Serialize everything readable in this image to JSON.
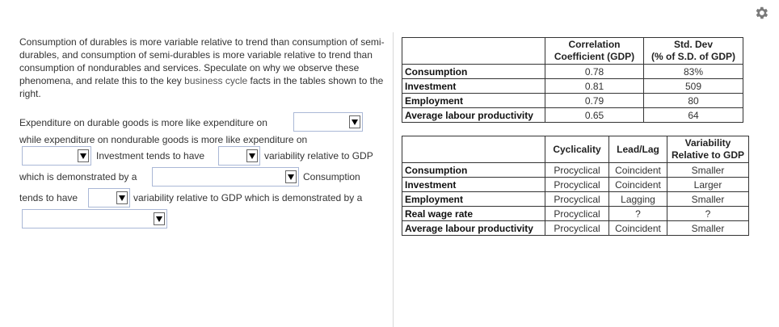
{
  "intro_text_1": "Consumption of durables is more variable relative to trend than consumption of semi-durables, and consumption of semi-durables is more variable relative to trend than consumption of nondurables and services. Speculate on why we observe these phenomena, and relate this to the key ",
  "intro_link": "business cycle",
  "intro_text_2": " facts in the tables shown to the right.",
  "sentence": {
    "s1": "Expenditure on durable goods is more like expenditure on",
    "s2": "while expenditure on nondurable goods is more like expenditure on",
    "s3": "Investment tends to have",
    "s4": "variability relative to GDP",
    "s5": "which is demonstrated by a",
    "s6": "Consumption",
    "s7": "tends to have",
    "s8": "variability relative to GDP which is demonstrated by a"
  },
  "table1": {
    "headers": [
      "",
      "Correlation Coefficient (GDP)",
      "Std. Dev (% of S.D. of GDP)"
    ],
    "h1a": "Correlation",
    "h1b": "Coefficient (GDP)",
    "h2a": "Std. Dev",
    "h2b": "(% of S.D. of GDP)",
    "rows": [
      {
        "label": "Consumption",
        "corr": "0.78",
        "sd": "83%"
      },
      {
        "label": "Investment",
        "corr": "0.81",
        "sd": "509"
      },
      {
        "label": "Employment",
        "corr": "0.79",
        "sd": "80"
      },
      {
        "label": "Average labour productivity",
        "corr": "0.65",
        "sd": "64"
      }
    ]
  },
  "table2": {
    "h_cyc": "Cyclicality",
    "h_lead": "Lead/Lag",
    "h_var_a": "Variability",
    "h_var_b": "Relative to GDP",
    "rows": [
      {
        "label": "Consumption",
        "cyc": "Procyclical",
        "lead": "Coincident",
        "var": "Smaller"
      },
      {
        "label": "Investment",
        "cyc": "Procyclical",
        "lead": "Coincident",
        "var": "Larger"
      },
      {
        "label": "Employment",
        "cyc": "Procyclical",
        "lead": "Lagging",
        "var": "Smaller"
      },
      {
        "label": "Real wage rate",
        "cyc": "Procyclical",
        "lead": "?",
        "var": "?"
      },
      {
        "label": "Average labour productivity",
        "cyc": "Procyclical",
        "lead": "Coincident",
        "var": "Smaller"
      }
    ]
  },
  "icons": {
    "settings": "gear-icon",
    "dropdown": "dropdown-arrow-icon"
  }
}
